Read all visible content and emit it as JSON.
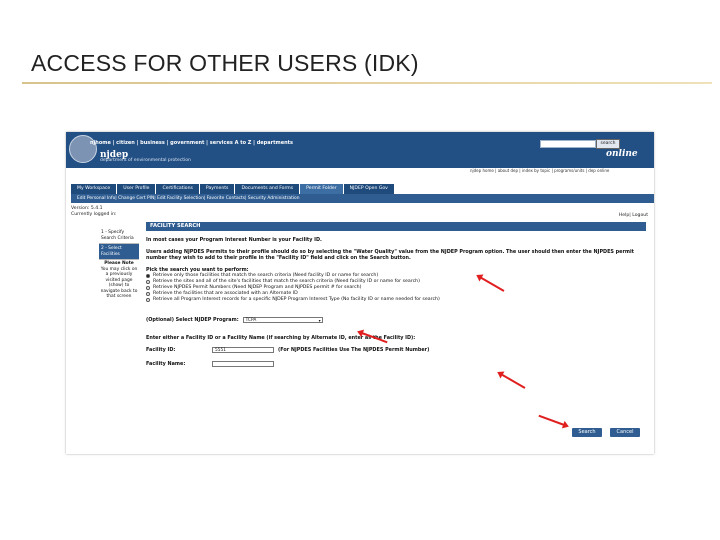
{
  "slide": {
    "title": "ACCESS FOR OTHER USERS (IDK)"
  },
  "portal": {
    "top_links": "njhome | citizen | business | government | services A to Z | departments",
    "search_button": "search",
    "brand": "njdep",
    "dept": "department of environmental protection",
    "online": "online",
    "util_links": "njdep home | about dep | index by topic | programs/units | dep online",
    "tabs": [
      "My Workspace",
      "User Profile",
      "Certifications",
      "Payments",
      "Documents and Forms",
      "Permit Folder",
      "NJDEP Open Gov"
    ],
    "subnav": "Edit Personal Info| Change Cert PIN| Edit Facility Selection| Favorite Contacts| Security Administration",
    "version": "Version: 5.4.1",
    "logged_in": "Currently logged in:",
    "help_links": "Help| Logout",
    "steps": [
      "1 - Specify Search Criteria",
      "2 - Select Facilities"
    ],
    "note_title": "Please Note",
    "note_body": "You may click on a previously visited page (show) to navigate back to that screen",
    "section_title": "FACILITY SEARCH",
    "intro": "In most cases your Program Interest Number is your Facility ID.",
    "users_text": "Users adding NJPDES Permits to their profile should do so by selecting the \"Water Quality\" value from the NJDEP Program option. The user should then enter the NJPDES permit number they wish to add to their profile in the \"Facility ID\" field and click on the Search button.",
    "pick_label": "Pick the search you want to perform:",
    "options": [
      "Retrieve only those facilities that match the search criteria (Need facility ID or name for search)",
      "Retrieve the sites and all of the site's facilities that match the search criteria (Need facility ID or name for search)",
      "Retrieve NJPDES Permit Numbers (Need NJDEP Program and NJPDES permit # for search)",
      "Retrieve the facilities that are associated with an Alternate ID",
      "Retrieve all Program Interest records for a specific NJDEP Program Interest Type (No facility ID or name needed for search)"
    ],
    "program_label": "(Optional) Select NJDEP Program:",
    "program_value": "TCPA",
    "enter_label": "Enter either a Facility ID or a Facility Name (if searching by Alternate ID, enter as the Facility ID):",
    "facility_id_label": "Facility ID:",
    "facility_id_value": "5551",
    "facility_hint": "(For NJPDES Facilities Use The NJPDES Permit Number)",
    "facility_name_label": "Facility Name:",
    "search_btn": "Search",
    "cancel_btn": "Cancel",
    "accent": "#2f5d91",
    "arrow_color": "#e02020"
  }
}
